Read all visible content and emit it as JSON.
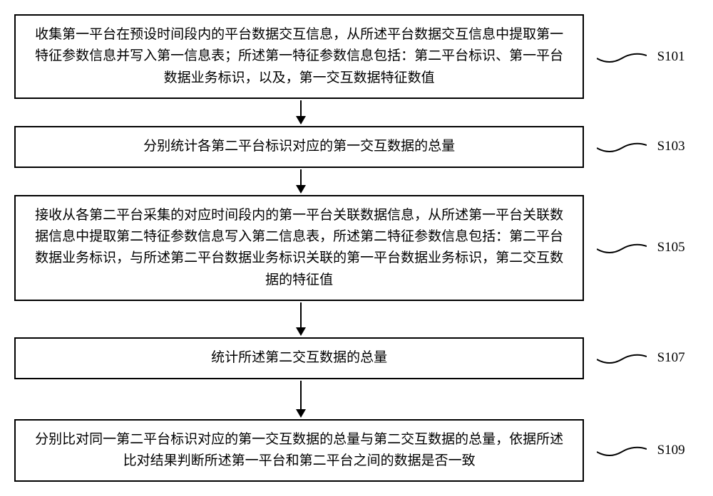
{
  "steps": [
    {
      "label": "S101",
      "text": "收集第一平台在预设时间段内的平台数据交互信息，从所述平台数据交互信息中提取第一特征参数信息并写入第一信息表；所述第一特征参数信息包括：第二平台标识、第一平台数据业务标识，以及，第一交互数据特征数值",
      "arrow_height": 22
    },
    {
      "label": "S103",
      "text": "分别统计各第二平台标识对应的第一交互数据的总量",
      "arrow_height": 22
    },
    {
      "label": "S105",
      "text": "接收从各第二平台采集的对应时间段内的第一平台关联数据信息，从所述第一平台关联数据信息中提取第二特征参数信息写入第二信息表，所述第二特征参数信息包括：第二平台数据业务标识，与所述第二平台数据业务标识关联的第一平台数据业务标识，第二交互数据的特征值",
      "arrow_height": 35
    },
    {
      "label": "S107",
      "text": "统计所述第二交互数据的总量",
      "arrow_height": 40
    },
    {
      "label": "S109",
      "text": "分别比对同一第二平台标识对应的第一交互数据的总量与第二交互数据的总量，依据所述比对结果判断所述第一平台和第二平台之间的数据是否一致",
      "arrow_height": 0
    }
  ]
}
